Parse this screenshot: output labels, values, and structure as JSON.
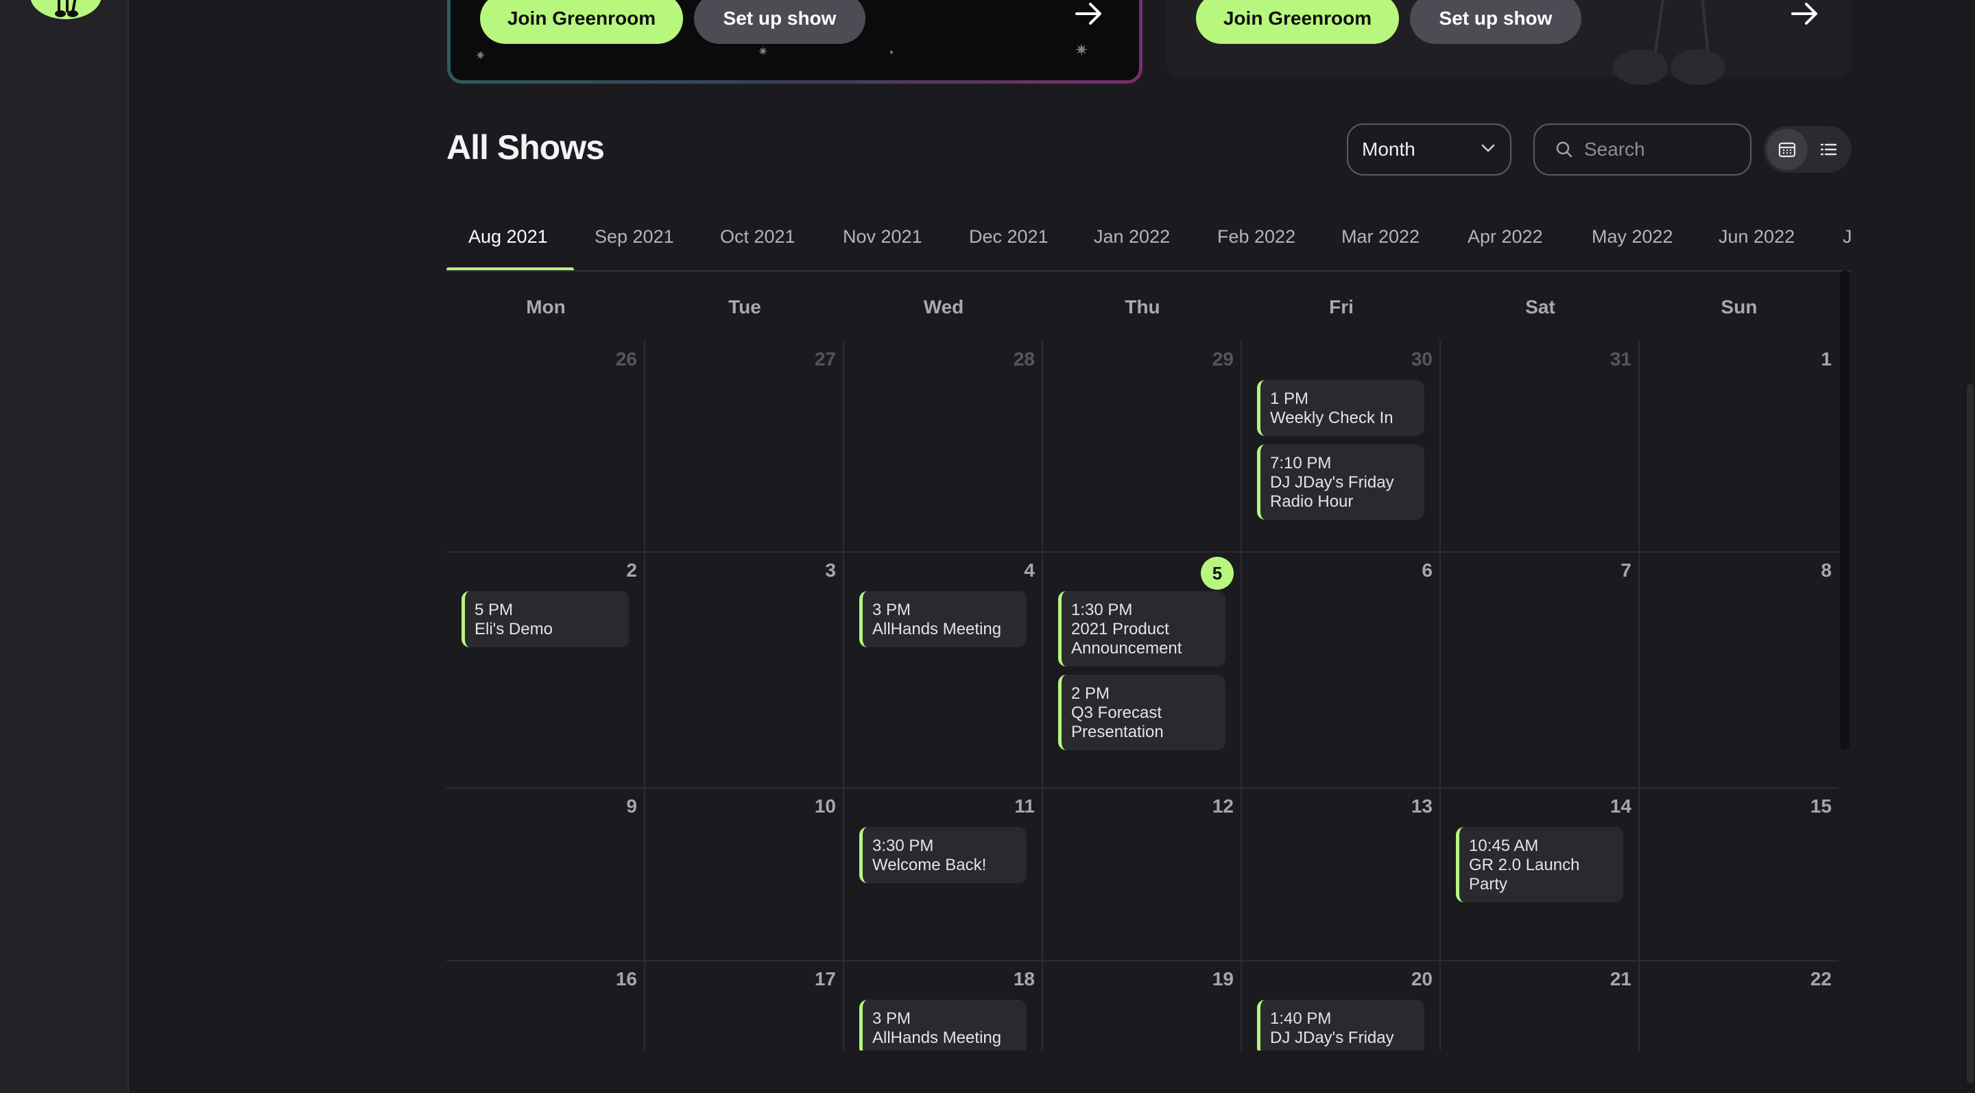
{
  "promo_left": {
    "join_label": "Join Greenroom",
    "setup_label": "Set up show"
  },
  "promo_right": {
    "join_label": "Join Greenroom",
    "setup_label": "Set up show"
  },
  "header": {
    "title": "All Shows",
    "view_select": "Month",
    "search_placeholder": "Search"
  },
  "month_tabs": [
    "Aug 2021",
    "Sep 2021",
    "Oct 2021",
    "Nov 2021",
    "Dec 2021",
    "Jan 2022",
    "Feb 2022",
    "Mar 2022",
    "Apr 2022",
    "May 2022",
    "Jun 2022",
    "J"
  ],
  "weekdays": [
    "Mon",
    "Tue",
    "Wed",
    "Thu",
    "Fri",
    "Sat",
    "Sun"
  ],
  "weeks": [
    {
      "days": [
        {
          "num": "26",
          "faded": true,
          "events": []
        },
        {
          "num": "27",
          "faded": true,
          "events": []
        },
        {
          "num": "28",
          "faded": true,
          "events": []
        },
        {
          "num": "29",
          "faded": true,
          "events": []
        },
        {
          "num": "30",
          "faded": true,
          "events": [
            {
              "time": "1 PM",
              "title": "Weekly Check In"
            },
            {
              "time": "7:10 PM",
              "title": "DJ JDay's Friday Radio Hour"
            }
          ]
        },
        {
          "num": "31",
          "faded": true,
          "events": []
        },
        {
          "num": "1",
          "events": []
        }
      ]
    },
    {
      "days": [
        {
          "num": "2",
          "events": [
            {
              "time": "5 PM",
              "title": "Eli's Demo"
            }
          ]
        },
        {
          "num": "3",
          "events": []
        },
        {
          "num": "4",
          "events": [
            {
              "time": "3 PM",
              "title": "AllHands Meeting"
            }
          ]
        },
        {
          "num": "5",
          "today": true,
          "events": [
            {
              "time": "1:30 PM",
              "title": "2021 Product Announcement"
            },
            {
              "time": "2 PM",
              "title": "Q3 Forecast Presentation"
            }
          ]
        },
        {
          "num": "6",
          "events": []
        },
        {
          "num": "7",
          "events": []
        },
        {
          "num": "8",
          "events": []
        }
      ]
    },
    {
      "days": [
        {
          "num": "9",
          "events": []
        },
        {
          "num": "10",
          "events": []
        },
        {
          "num": "11",
          "events": [
            {
              "time": "3:30 PM",
              "title": "Welcome Back!"
            }
          ]
        },
        {
          "num": "12",
          "events": []
        },
        {
          "num": "13",
          "events": []
        },
        {
          "num": "14",
          "events": [
            {
              "time": "10:45 AM",
              "title": "GR 2.0 Launch Party"
            }
          ]
        },
        {
          "num": "15",
          "events": []
        }
      ]
    },
    {
      "days": [
        {
          "num": "16",
          "events": []
        },
        {
          "num": "17",
          "events": []
        },
        {
          "num": "18",
          "events": [
            {
              "time": "3 PM",
              "title": "AllHands Meeting"
            }
          ]
        },
        {
          "num": "19",
          "events": []
        },
        {
          "num": "20",
          "events": [
            {
              "time": "1:40 PM",
              "title": "DJ JDay's Friday"
            }
          ]
        },
        {
          "num": "21",
          "events": []
        },
        {
          "num": "22",
          "events": []
        }
      ]
    }
  ],
  "colors": {
    "accent": "#b7f77e",
    "background": "#1b1b1f",
    "event_bg": "#2a2a2e"
  }
}
